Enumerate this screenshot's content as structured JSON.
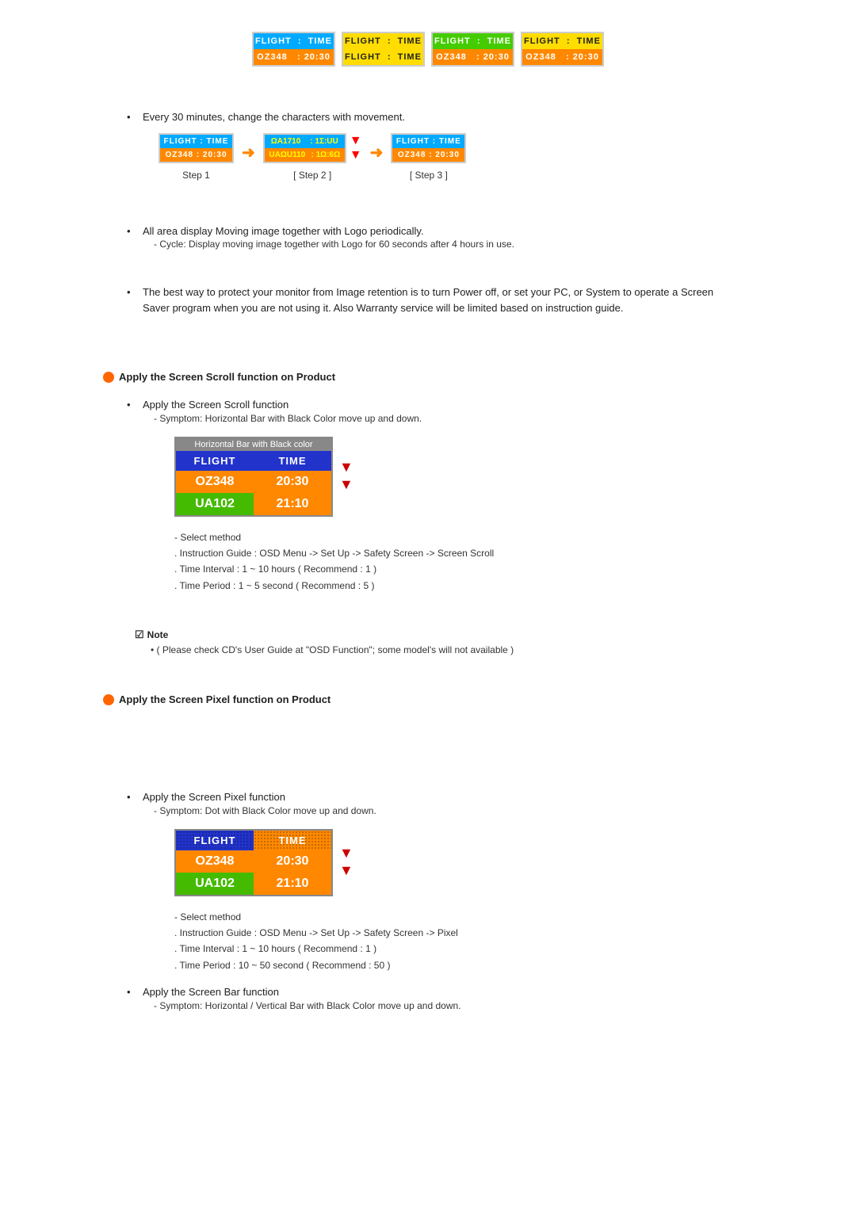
{
  "top_cards": [
    {
      "top": "FLIGHT : TIME",
      "bottom": "OZ348   : 20:30",
      "variant": "blue-orange"
    },
    {
      "top": "FLIGHT : TIME",
      "bottom": "FLIGHT : TIME",
      "variant": "yellow"
    },
    {
      "top": "FLIGHT : TIME",
      "bottom": "OZ348   : 20:30",
      "variant": "green-orange"
    },
    {
      "top": "FLIGHT : TIME",
      "bottom": "OZ348   : 20:30",
      "variant": "yellow-orange"
    }
  ],
  "bullet1": {
    "text": "Every 30 minutes, change the characters with movement.",
    "steps": [
      "Step 1",
      "Step 2",
      "Step 3"
    ]
  },
  "bullet2": {
    "text": "All area display Moving image together with Logo periodically.",
    "sub": "- Cycle: Display moving image together with Logo for 60 seconds after 4 hours in use."
  },
  "bullet3": {
    "text": "The best way to protect your monitor from Image retention is to turn Power off, or set your PC, or System to operate a Screen Saver program when you are not using it. Also Warranty service will be limited based on instruction guide."
  },
  "section_scroll": {
    "heading": "Apply the Screen Scroll function on Product",
    "bullet1": "Apply the Screen Scroll function",
    "bullet1_sub": "- Symptom: Horizontal Bar with Black Color move up and down.",
    "table_header": "Horizontal Bar with Black color",
    "rows": [
      {
        "left": "FLIGHT",
        "right": "TIME",
        "left_class": "blue",
        "right_class": "blue"
      },
      {
        "left": "OZ348",
        "right": "20:30",
        "left_class": "orange",
        "right_class": "orange"
      },
      {
        "left": "UA102",
        "right": "21:10",
        "left_class": "green",
        "right_class": "orange"
      }
    ],
    "method_title": "- Select method",
    "method_lines": [
      ". Instruction Guide : OSD Menu -> Set Up -> Safety Screen -> Screen Scroll",
      ". Time Interval : 1 ~ 10 hours ( Recommend : 1 )",
      ". Time Period : 1 ~ 5 second ( Recommend : 5 )"
    ]
  },
  "note": {
    "title": "Note",
    "text": "( Please check CD's User Guide at \"OSD Function\"; some model's will not available )"
  },
  "section_pixel": {
    "heading": "Apply the Screen Pixel function on Product",
    "bullet1": "Apply the Screen Pixel function",
    "bullet1_sub": "- Symptom: Dot with Black Color move up and down.",
    "table_header": "",
    "rows": [
      {
        "left": "FLIGHT",
        "right": "TIME",
        "left_class": "blue-dotted",
        "right_class": "orange-dotted"
      },
      {
        "left": "OZ348",
        "right": "20:30",
        "left_class": "orange",
        "right_class": "orange"
      },
      {
        "left": "UA102",
        "right": "21:10",
        "left_class": "green",
        "right_class": "orange"
      }
    ],
    "method_title": "- Select method",
    "method_lines": [
      ". Instruction Guide : OSD Menu -> Set Up -> Safety Screen -> Pixel",
      ". Time Interval : 1 ~ 10 hours ( Recommend : 1 )",
      ". Time Period : 10 ~ 50 second ( Recommend : 50 )"
    ]
  },
  "section_bar": {
    "heading": "Apply the Screen Bar function",
    "bullet1_sub": "- Symptom: Horizontal / Vertical Bar with Black Color move up and down."
  }
}
